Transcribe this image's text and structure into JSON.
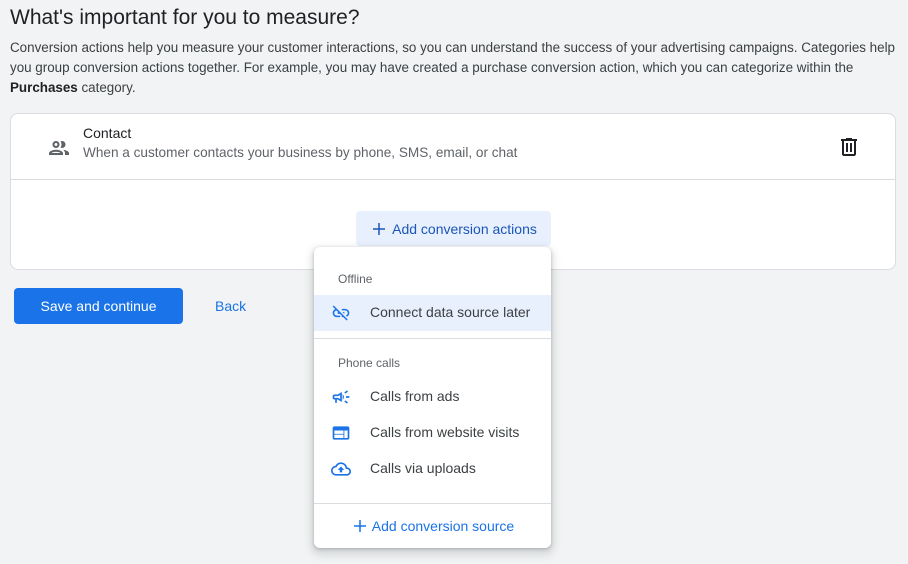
{
  "page": {
    "title": "What's important for you to measure?",
    "intro_part1": "Conversion actions help you measure your customer interactions, so you can understand the success of your advertising campaigns. Categories help you group conversion actions together. For example, you may have created a purchase conversion action, which you can categorize within the ",
    "intro_bold": "Purchases",
    "intro_part2": " category."
  },
  "category_card": {
    "icon": "people-icon",
    "title": "Contact",
    "description": "When a customer contacts your business by phone, SMS, email, or chat",
    "delete_icon": "trash-icon",
    "add_actions_label": "Add conversion actions"
  },
  "footer": {
    "save_label": "Save and continue",
    "back_label": "Back"
  },
  "dropdown": {
    "sections": [
      {
        "label": "Offline",
        "items": [
          {
            "label": "Connect data source later",
            "icon": "link-off-icon",
            "highlighted": true
          }
        ]
      },
      {
        "label": "Phone calls",
        "items": [
          {
            "label": "Calls from ads",
            "icon": "megaphone-icon"
          },
          {
            "label": "Calls from website visits",
            "icon": "web-icon"
          },
          {
            "label": "Calls via uploads",
            "icon": "cloud-upload-icon"
          }
        ]
      }
    ],
    "add_source_label": "Add conversion source"
  },
  "colors": {
    "accent": "#1a73e8",
    "page_background": "#f1f3f4",
    "highlight": "#e8f0fe"
  }
}
